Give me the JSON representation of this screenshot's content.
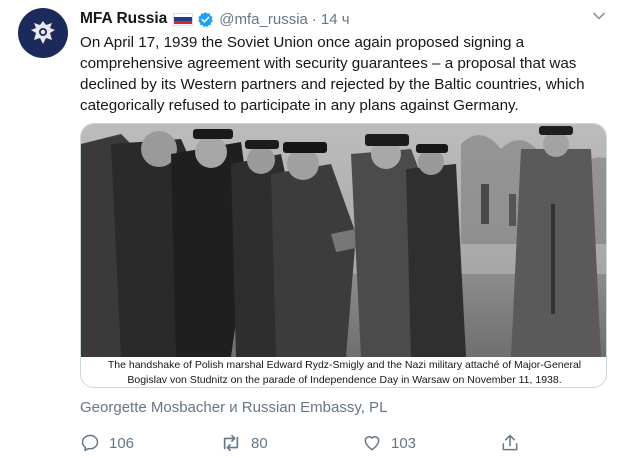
{
  "tweet": {
    "author_name": "MFA Russia",
    "handle": "@mfa_russia",
    "separator": "·",
    "time": "14 ч",
    "text_lines": [
      "On April 17, 1939 the Soviet Union once again proposed signing a",
      "comprehensive agreement with security guarantees – a proposal that was",
      "declined by its Western partners and rejected by the Baltic countries, which",
      "categorically refused to participate in any plans against Germany."
    ],
    "image_caption_lines": [
      "The handshake of Polish marshal Edward Rydz-Smigly and the Nazi military attaché of Major-General",
      "Bogislav von Studnitz on the parade of Independence Day in Warsaw on November 11, 1938."
    ],
    "liked_by": "Georgette Mosbacher и Russian Embassy, PL",
    "actions": {
      "reply_count": "106",
      "retweet_count": "80",
      "like_count": "103"
    }
  },
  "icons": {
    "avatar": "russian-coat-of-arms",
    "flag": "russia-flag",
    "verified": "verified-badge-icon",
    "menu": "chevron-down-icon",
    "reply": "reply-icon",
    "retweet": "retweet-icon",
    "like": "heart-icon",
    "share": "share-icon"
  },
  "colors": {
    "text": "#14171a",
    "secondary": "#657786",
    "verified": "#1da1f2",
    "avatar_bg": "#1b2a5a",
    "flag": [
      "#ffffff",
      "#1c3f94",
      "#d52b1e"
    ]
  }
}
